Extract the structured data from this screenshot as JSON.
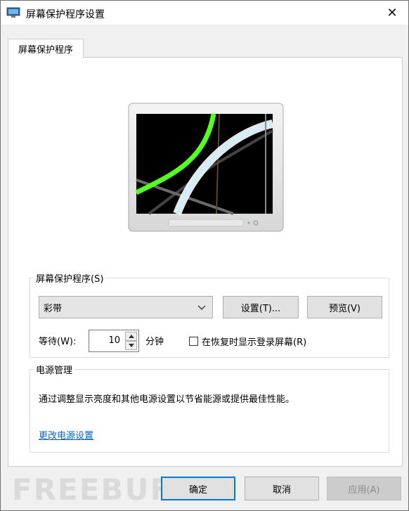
{
  "window": {
    "title": "屏幕保护程序设置",
    "close_glyph": "✕"
  },
  "tabs": [
    {
      "label": "屏幕保护程序"
    }
  ],
  "screensaver": {
    "group_label": "屏幕保护程序(S)",
    "selected": "彩带",
    "settings_label": "设置(T)...",
    "preview_label": "预览(V)",
    "wait_label": "等待(W):",
    "wait_value": "10",
    "minutes_label": "分钟",
    "resume_checkbox_label": "在恢复时显示登录屏幕(R)",
    "resume_checked": false
  },
  "power": {
    "group_label": "电源管理",
    "description": "通过调整显示亮度和其他电源设置以节省能源或提供最佳性能。",
    "link_label": "更改电源设置"
  },
  "buttons": {
    "ok": "确定",
    "cancel": "取消",
    "apply": "应用(A)"
  },
  "watermark": "FREEBUF",
  "colors": {
    "accent": "#0078d7",
    "link": "#0066cc"
  }
}
